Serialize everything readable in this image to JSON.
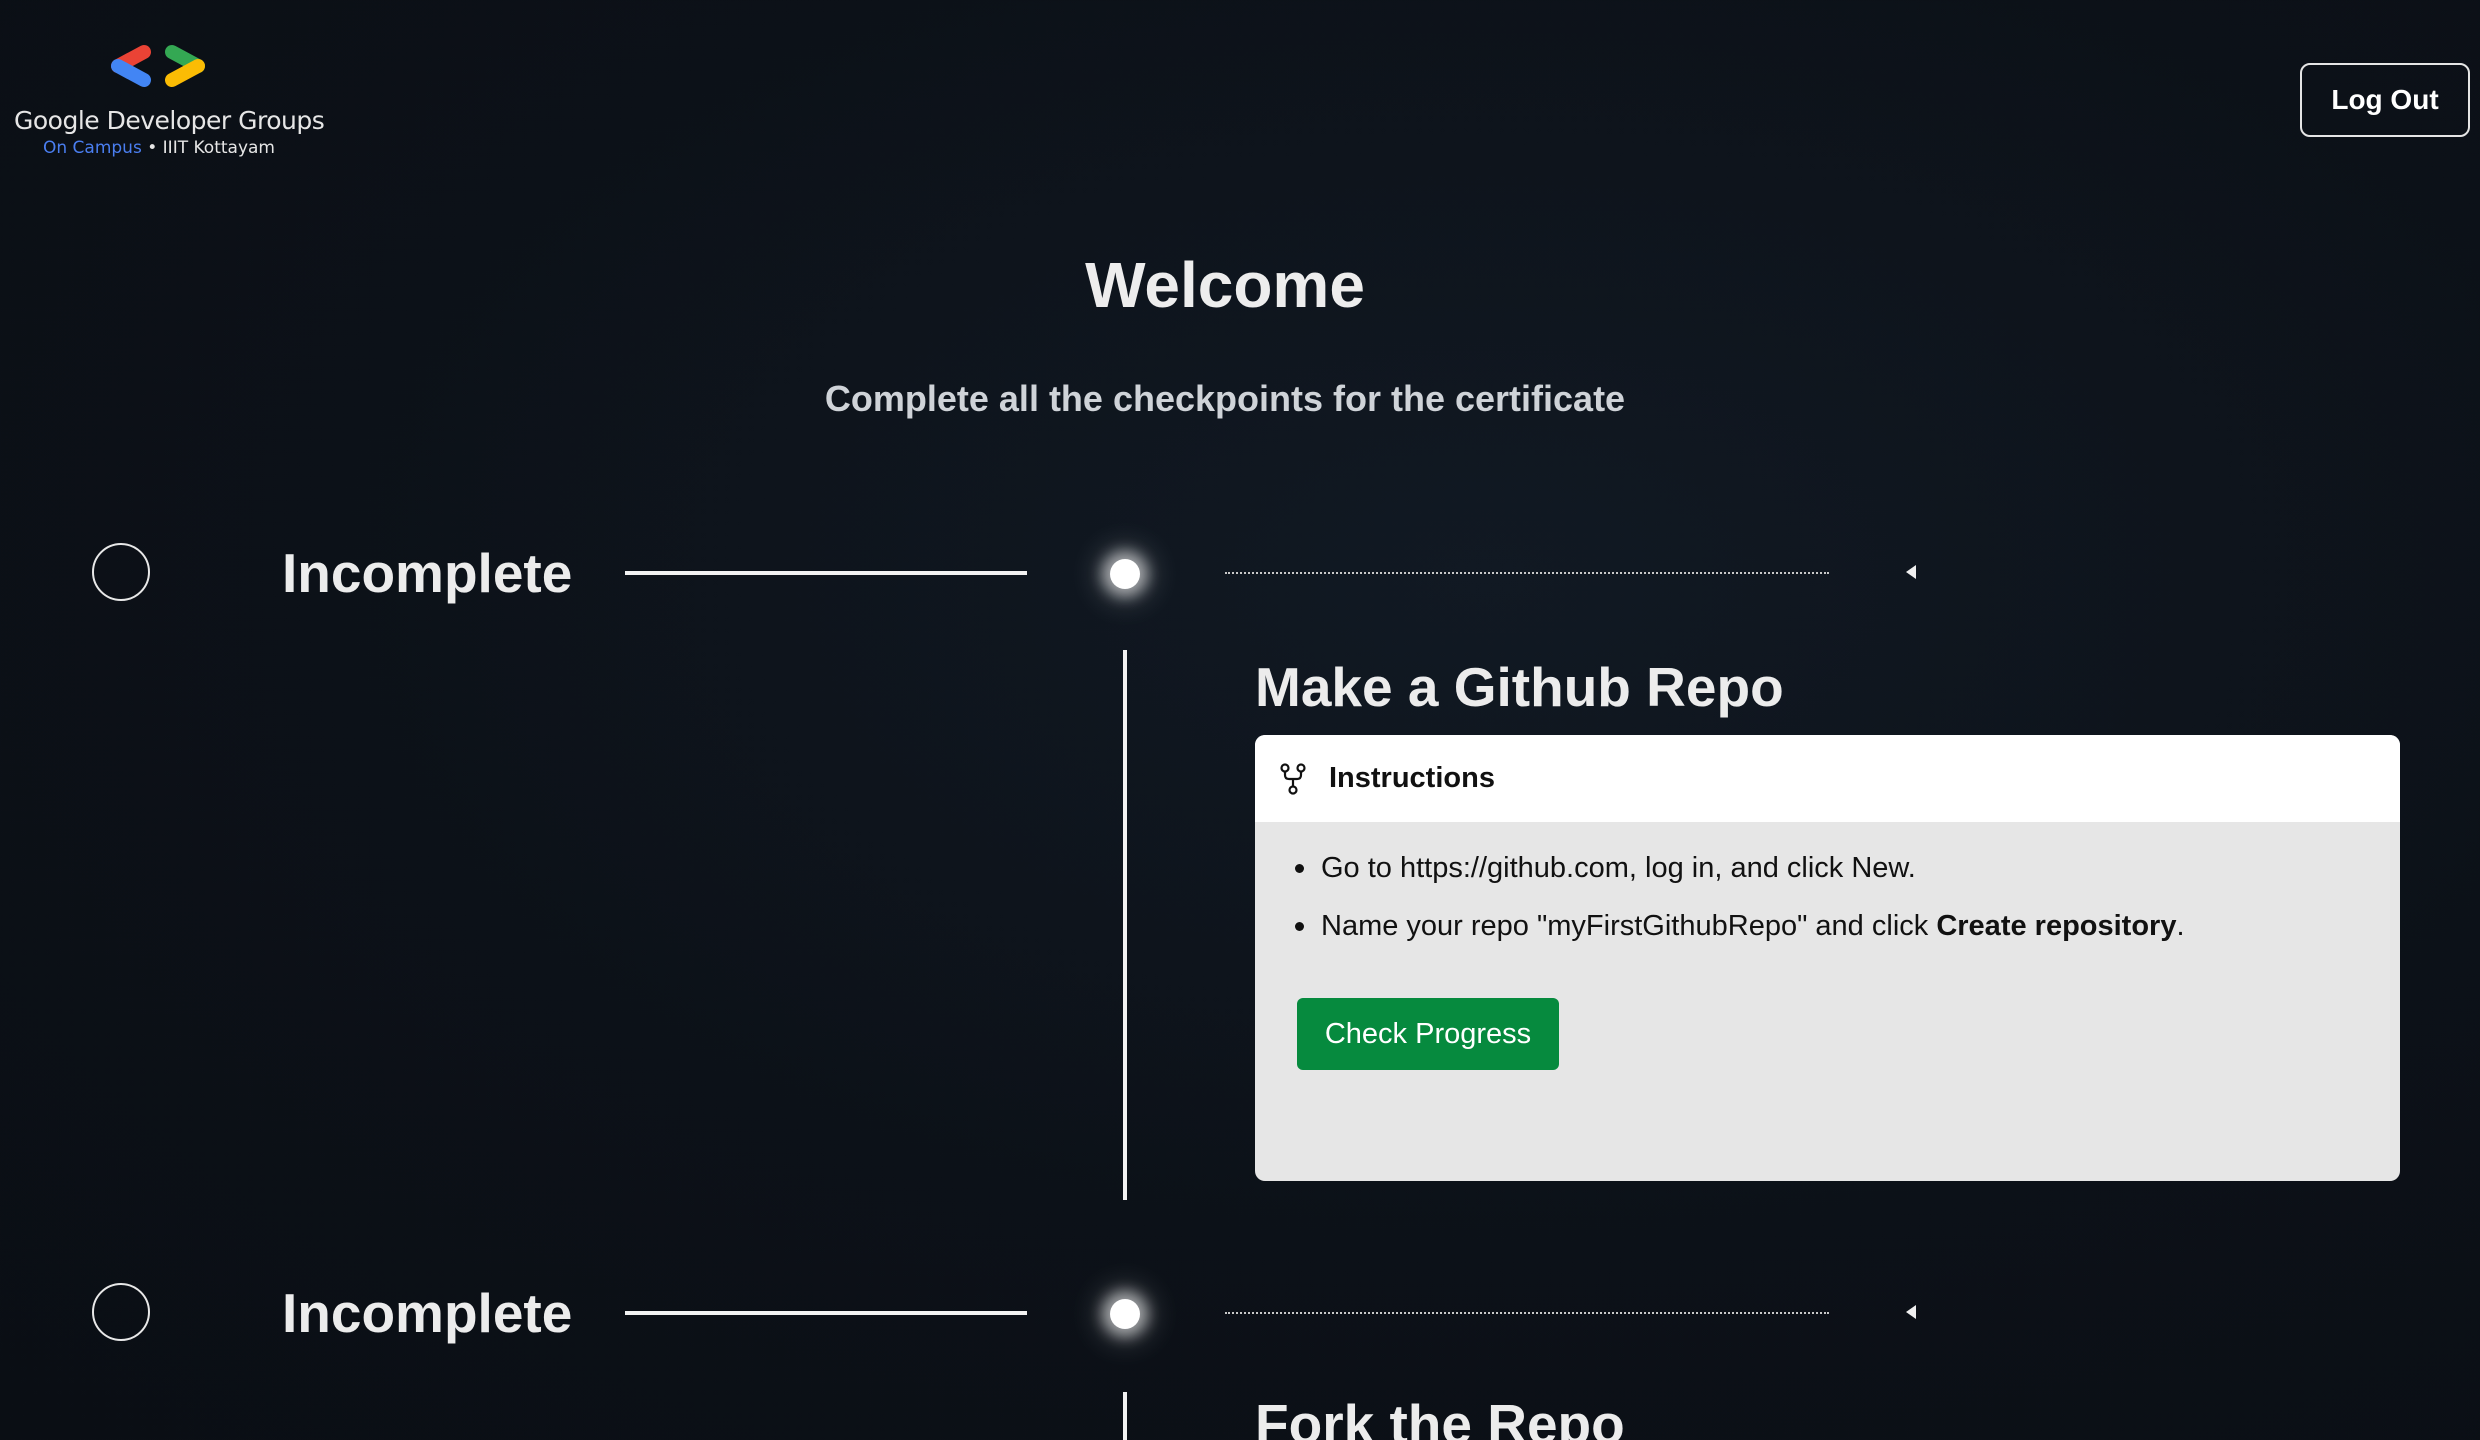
{
  "header": {
    "logo_title": "Google Developer Groups",
    "logo_campus": "On Campus",
    "logo_dot": " • ",
    "logo_institution": "IIIT Kottayam",
    "logout_label": "Log Out"
  },
  "hero": {
    "title": "Welcome",
    "subtitle": "Complete all the checkpoints for the certificate"
  },
  "checkpoints": [
    {
      "status": "Incomplete",
      "title": "Make a Github Repo",
      "card": {
        "header_title": "Instructions",
        "header_icon": "git-fork-icon",
        "step1": "Go to https://github.com, log in, and click New.",
        "step2_prefix": "Name your repo \"myFirstGithubRepo\" and click ",
        "step2_bold": "Create repository",
        "step2_suffix": ".",
        "button_label": "Check Progress"
      }
    },
    {
      "status": "Incomplete",
      "title": "Fork the Repo"
    }
  ],
  "colors": {
    "background": "#0c1118",
    "primary_button": "#068a3e",
    "google_blue": "#4285f4",
    "google_red": "#ea4335",
    "google_green": "#34a853",
    "google_yellow": "#fbbc04"
  }
}
